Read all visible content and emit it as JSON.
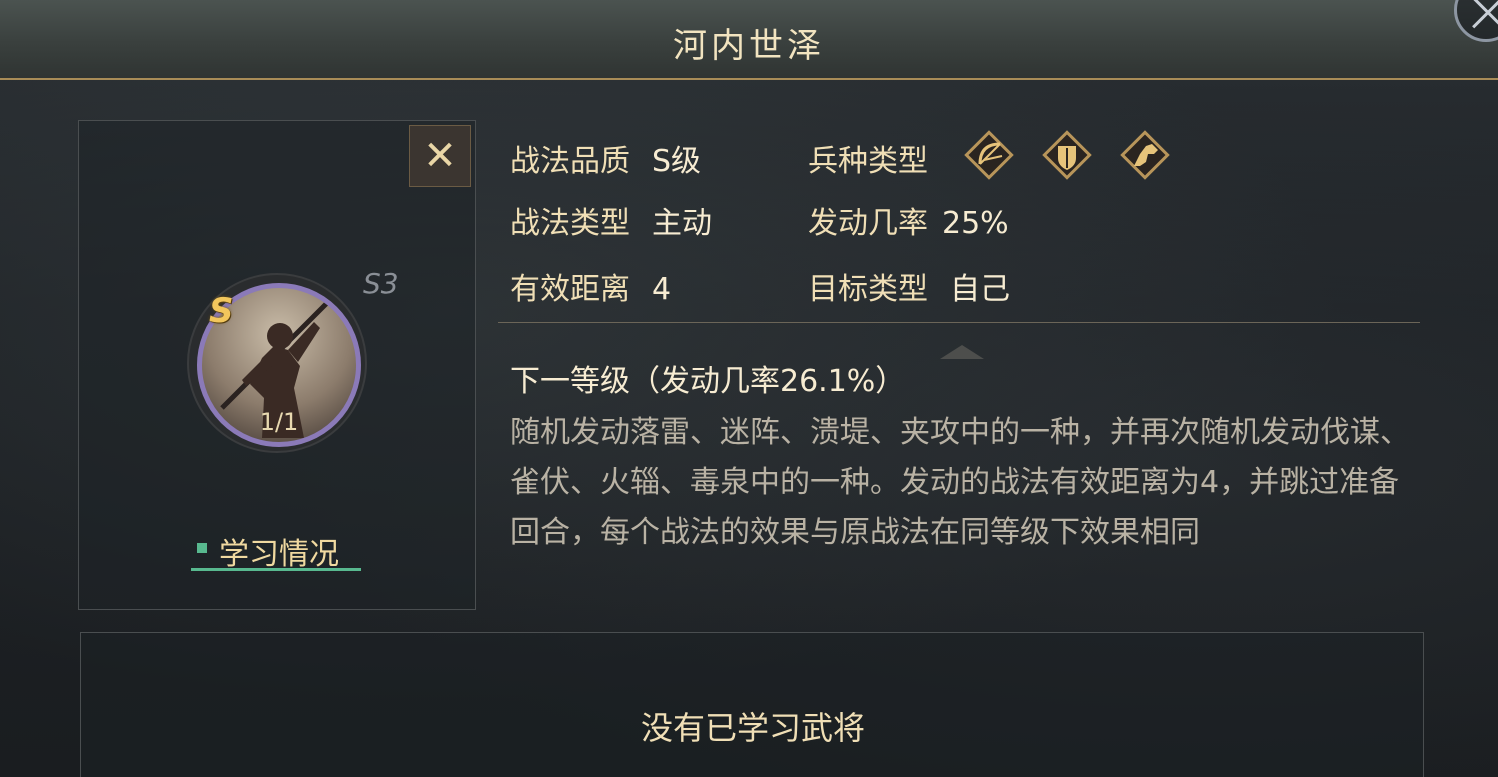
{
  "header": {
    "title": "河内世泽",
    "close_icon": "close-icon"
  },
  "skill_card": {
    "remove_label": "✕",
    "grade_badge": "S",
    "season": "S3",
    "count": "1/1",
    "study_tab_label": "学习情况"
  },
  "attributes": {
    "quality": {
      "label": "战法品质",
      "value": "S级"
    },
    "type": {
      "label": "战法类型",
      "value": "主动"
    },
    "range": {
      "label": "有效距离",
      "value": "4"
    },
    "troop": {
      "label": "兵种类型",
      "icons": [
        "archer-icon",
        "shield-icon",
        "cavalry-icon"
      ]
    },
    "trigger": {
      "label": "发动几率",
      "value": "25%"
    },
    "target": {
      "label": "目标类型",
      "value": "自己"
    }
  },
  "next_level": "下一等级（发动几率26.1%）",
  "description": "随机发动落雷、迷阵、溃堤、夹攻中的一种，并再次随机发动伐谋、雀伏、火辎、毒泉中的一种。发动的战法有效距离为4，并跳过准备回合，每个战法的效果与原战法在同等级下效果相同",
  "learned": {
    "empty_message": "没有已学习武将"
  },
  "colors": {
    "accent_gold": "#a88c57",
    "tab_green": "#58b98f",
    "portrait_ring": "#8b7ab8"
  }
}
